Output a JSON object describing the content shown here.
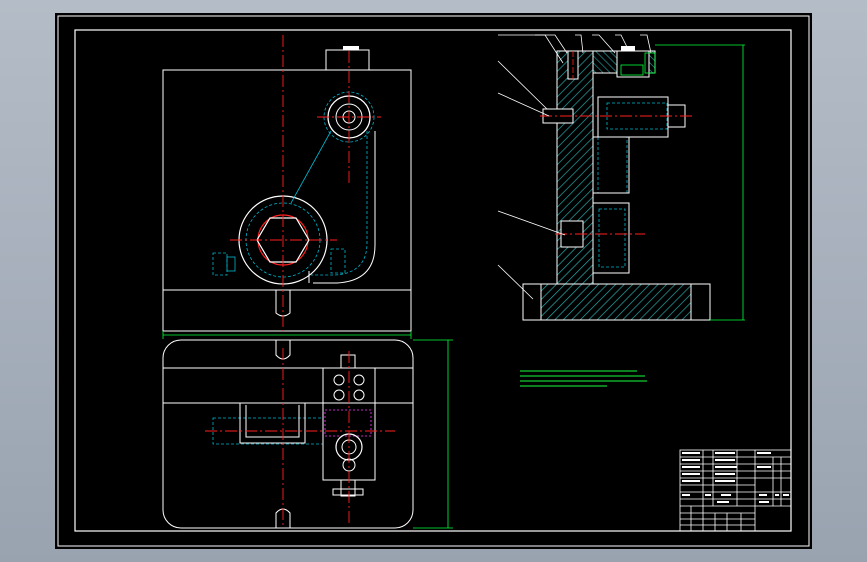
{
  "colors": {
    "background": "#a3acb8",
    "paper": "#000000",
    "border": "#ffffff",
    "centerline": "#ff2020",
    "hidden": "#00b7d0",
    "dimension": "#00ff3c",
    "hatch": "#2aa7a7",
    "outline": "#ffffff",
    "magenta": "#ff36ff",
    "note": "#19ff3c"
  },
  "icons": [
    "drawing-frame",
    "title-block",
    "balloon-leader",
    "section-hatch"
  ],
  "drawing": {
    "plate_label": "",
    "notes_heading": "",
    "title_block_text": ""
  }
}
